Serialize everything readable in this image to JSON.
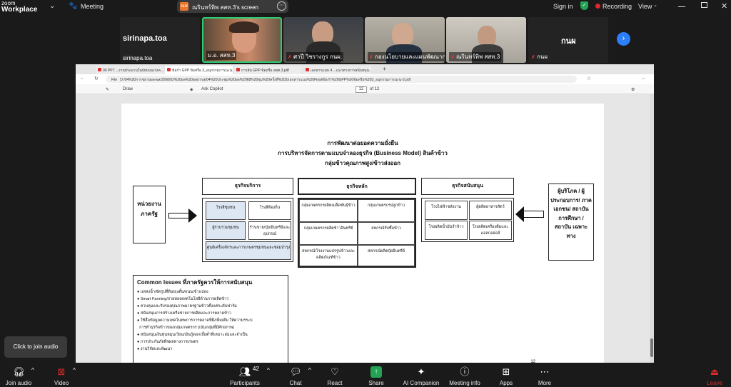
{
  "topbar": {
    "logo_line1": "zoom",
    "logo_line2": "Workplace",
    "meeting_label": "Meeting",
    "share_badge": "ณฟ",
    "share_label": "ณรินทร์ทิพ สสท.3's screen",
    "signin": "Sign in",
    "recording": "Recording",
    "view": "View"
  },
  "tiles": {
    "left_name_big": "sirinapa.toa",
    "left_name_small": "sirinapa.toa",
    "t1_name": "ม.อ. สสท.3",
    "t2_name": "ศาปี วิชรางกูร กนผ.",
    "t3_name": "กองนโยบายและแผนพัฒนาก...",
    "t4_name": "ณรินทร์ทิพ สสท.3",
    "right_name_big": "กนผ",
    "right_name_small": "กนผ"
  },
  "browser": {
    "tabs": [
      "00 PPT ...งานประมานในปยบบนเร่งค...",
      "ข้อกำ GPP ข้อหรือ 3_อนุกรรมการนะน...",
      "การสัม GPP ข้อหรือ สสท.3.pdf",
      "เอกสารแนบ 4 ...แนวทางการสนับสนุน..."
    ],
    "file_label": "File",
    "url": "D:/04%20การขยายผล-ผล/2568/02%20ผล%20ผลบรรลุ/04%20ประชุม%20ผล%2068%20ชุม%20ครั้งที่%202/เอกสารแนบ%20Final/ข้อกำ%20GPP%20ข้อหรือ%203_อนุกรรมการนะน-3.pdf",
    "draw_label": "Draw",
    "copilot_label": "Ask Copilot",
    "page_current": "12",
    "page_total": "of 12"
  },
  "doc": {
    "title1": "การพัฒนาต่อยอดความยั่งยืน",
    "title2": "การบริหารจัดการตามแบบจำลองธุรกิจ (Business Model) สินค้าข้าว",
    "title3": "กลุ่มข้าวคุณภาพสูง/ข้าวส่งออก",
    "left_unit": "หน่วยงานภาครัฐ",
    "service_header": "ธุรกิจบริการ",
    "service_cells": [
      "โรงสีชุมชน",
      "โรงสีท้องถิ่น",
      "ผู้รวบรวมชุมชน",
      "ร้านขาย/ปุ๋ย/อินทรีย์และอุปกรณ์",
      "ศูนย์เครื่องจักรและการเกษตรชุมชนและซ่อมบำรุง"
    ],
    "core_header": "ธุรกิจหลัก",
    "core_cells": [
      "กลุ่มเกษตรกรผลิตเมล็ดพันธุ์ข้าว",
      "กลุ่มเกษตรกรปลูกข้าว",
      "กลุ่มเกษตรกรผลิตข้าวอินทรีย์",
      "สหกรณ์รับซื้อข้าว",
      "สหกรณ์/โรงงานแปรรูปข้าวและผลิตภัณฑ์ข้าว",
      "สหกรณ์ผลิตปุ๋ยอินทรีย์"
    ],
    "support_header": "ธุรกิจสนับสนุน",
    "support_cells": [
      "โรงไฟฟ้าชลังงาน",
      "ผู้ผลิตอาหารสัตว์",
      "โรงผลิตน้ำมันรำข้าว",
      "โรงผลิตเครื่องดื่มและ แอลกอฮอล์"
    ],
    "right_unit": "ผู้บริโภค / ผู้ประกอบการ/ ภาคเอกชน/ สถาบัน การศึกษา / สถาบัน เฉพาะทาง",
    "issues_header": "Common Issues ที่ภาครัฐควรให้การสนับสนุน",
    "issues": [
      "แหล่งน้ำ/จัดรูปที่ดิน/ถุงตั้น/ถนนเข้าแปลง",
      "Smart Farming/ถ่ายทอดเทคโนโลยีด้านการผลิตข้าว",
      "ควบคุมและรับรองคุณภาพมาตรฐานข้าวตั้งแต่ระดับฟาร์ม",
      "สนับสนุนการสร้างเครือข่ายการผลิตและการตลาดข้าว",
      "ใช้สื่อข้อมูลความเทคโนทพการการตลาดที่มี/เพิ่มเติม ให้ความรระบ",
      "การทำธุรกิจข้าวของกลุ่มเกษตรกร (เน้นกลุ่มที่มีศักยภาพ)",
      "สนับสนุนเงินทุนหมุนเวียน/เงินกู้ดอกเบี้ยต่ำที่เหมาะสมและจำเป็น",
      "การประกันภัยพืชผลทางการเกษตร",
      "งานวิจัยและพัฒนา"
    ],
    "page_number": "12"
  },
  "tooltip": "Click to join audio",
  "bottombar": {
    "join_audio": "Join audio",
    "video": "Video",
    "participants": "Participants",
    "participants_count": "42",
    "chat": "Chat",
    "react": "React",
    "share": "Share",
    "ai_companion": "AI Companion",
    "meeting_info": "Meeting info",
    "apps": "Apps",
    "more": "More",
    "leave": "Leave"
  },
  "colors": {
    "share_green": "#23a455",
    "leave_red": "#e02828",
    "highlight_cell": "#dde7f3"
  }
}
